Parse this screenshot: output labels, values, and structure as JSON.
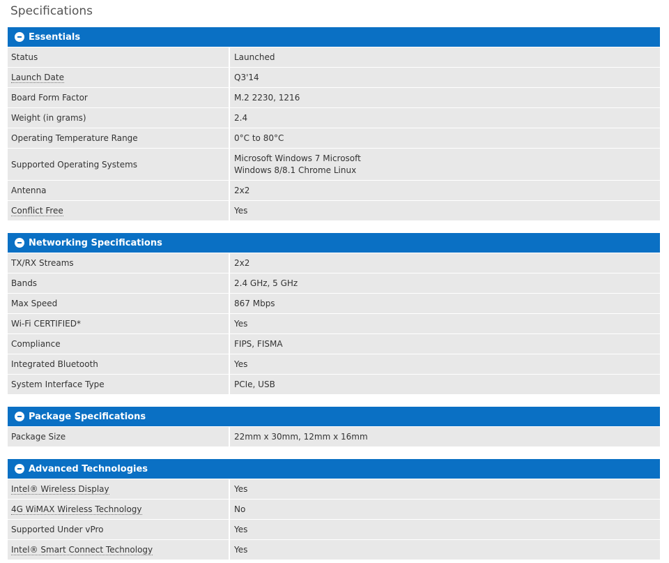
{
  "page_title": "Specifications",
  "sections": [
    {
      "title": "Essentials",
      "rows": [
        {
          "label": "Status",
          "value": "Launched"
        },
        {
          "label": "Launch Date",
          "value": "Q3'14"
        },
        {
          "label": "Board Form Factor",
          "value": "M.2 2230, 1216"
        },
        {
          "label": "Weight (in grams)",
          "value": "2.4"
        },
        {
          "label": "Operating Temperature Range",
          "value": "0°C to 80°C"
        },
        {
          "label": "Supported Operating Systems",
          "value_line1": "Microsoft Windows 7 Microsoft",
          "value_line2": "Windows 8/8.1 Chrome Linux"
        },
        {
          "label": "Antenna",
          "value": "2x2"
        },
        {
          "label": "Conflict Free",
          "value": "Yes"
        }
      ]
    },
    {
      "title": "Networking Specifications",
      "rows": [
        {
          "label": "TX/RX Streams",
          "value": "2x2"
        },
        {
          "label": "Bands",
          "value": "2.4 GHz, 5 GHz"
        },
        {
          "label": "Max Speed",
          "value": "867 Mbps"
        },
        {
          "label": "Wi-Fi CERTIFIED*",
          "value": "Yes"
        },
        {
          "label": "Compliance",
          "value": "FIPS, FISMA"
        },
        {
          "label": "Integrated Bluetooth",
          "value": "Yes"
        },
        {
          "label": "System Interface Type",
          "value": "PCIe, USB"
        }
      ]
    },
    {
      "title": "Package Specifications",
      "rows": [
        {
          "label": "Package Size",
          "value": "22mm x 30mm, 12mm x 16mm"
        }
      ]
    },
    {
      "title": "Advanced Technologies",
      "rows": [
        {
          "label": "Intel® Wireless Display",
          "value": "Yes"
        },
        {
          "label": "4G WiMAX Wireless Technology",
          "value": "No"
        },
        {
          "label": "Supported Under vPro",
          "value": "Yes"
        },
        {
          "label": "Intel® Smart Connect Technology",
          "value": "Yes"
        }
      ]
    }
  ],
  "colors": {
    "header_blue": "#0a70c4",
    "row_gray": "#e8e8e8"
  }
}
